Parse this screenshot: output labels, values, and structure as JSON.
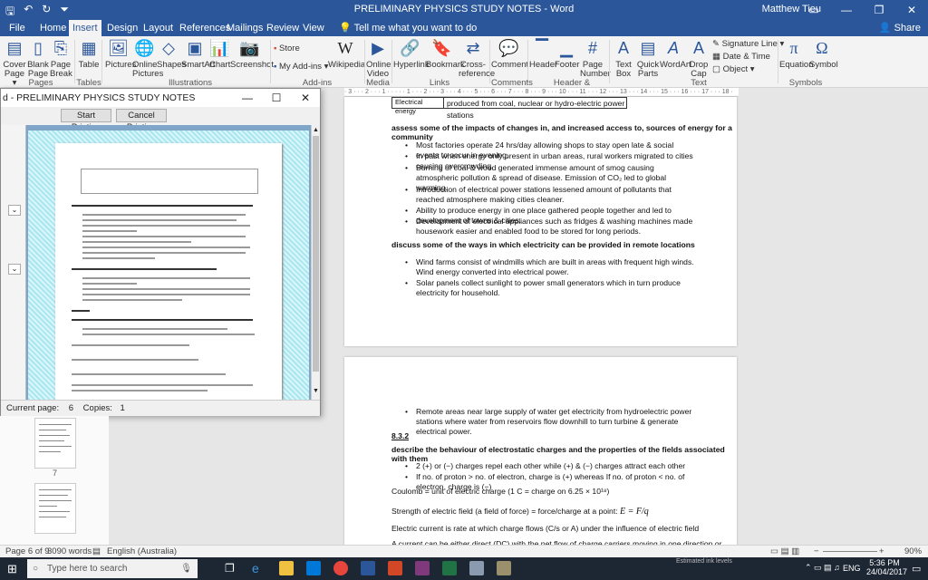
{
  "window": {
    "title": "PRELIMINARY PHYSICS STUDY NOTES - Word",
    "user": "Matthew Tieu",
    "share": "Share",
    "tell_me": "Tell me what you want to do"
  },
  "tabs": [
    "File",
    "Home",
    "Insert",
    "Design",
    "Layout",
    "References",
    "Mailings",
    "Review",
    "View"
  ],
  "ribbon": {
    "buttons": [
      {
        "label": "Cover Page ▾",
        "icon": "cover-page-icon"
      },
      {
        "label": "Blank Page",
        "icon": "blank-page-icon"
      },
      {
        "label": "Page Break",
        "icon": "page-break-icon"
      },
      {
        "label": "Table",
        "icon": "table-icon"
      },
      {
        "label": "Pictures",
        "icon": "pictures-icon"
      },
      {
        "label": "Online Pictures",
        "icon": "online-pictures-icon"
      },
      {
        "label": "Shapes",
        "icon": "shapes-icon"
      },
      {
        "label": "SmartArt",
        "icon": "smartart-icon"
      },
      {
        "label": "Chart",
        "icon": "chart-icon"
      },
      {
        "label": "Screenshot",
        "icon": "screenshot-icon"
      },
      {
        "label": "Wikipedia",
        "icon": "wikipedia-icon"
      },
      {
        "label": "Online Video",
        "icon": "online-video-icon"
      },
      {
        "label": "Hyperlink",
        "icon": "hyperlink-icon"
      },
      {
        "label": "Bookmark",
        "icon": "bookmark-icon"
      },
      {
        "label": "Cross-reference",
        "icon": "cross-reference-icon"
      },
      {
        "label": "Comment",
        "icon": "comment-icon"
      },
      {
        "label": "Header",
        "icon": "header-icon"
      },
      {
        "label": "Footer",
        "icon": "footer-icon"
      },
      {
        "label": "Page Number",
        "icon": "page-number-icon"
      },
      {
        "label": "Text Box",
        "icon": "text-box-icon"
      },
      {
        "label": "Quick Parts",
        "icon": "quick-parts-icon"
      },
      {
        "label": "WordArt",
        "icon": "wordart-icon"
      },
      {
        "label": "Drop Cap",
        "icon": "drop-cap-icon"
      },
      {
        "label": "Equation",
        "icon": "equation-icon"
      },
      {
        "label": "Symbol",
        "icon": "symbol-icon"
      }
    ],
    "store": "Store",
    "my_addins": "My Add-ins",
    "signature_line": "Signature Line",
    "date_time": "Date & Time",
    "object": "Object",
    "groups": [
      "Pages",
      "Tables",
      "Illustrations",
      "Add-ins",
      "Media",
      "Links",
      "Comments",
      "Header & Footer",
      "Text",
      "Symbols"
    ]
  },
  "ruler": "· 3 · · · 2 · · · 1 · · · · · 1 · · · 2 · · · 3 · · · 4 · · · 5 · · · 6 · · · 7 · · · 8 · · · 9 · · · 10 · · · 11 · · · 12 · · · 13 · · · 14 · · · 15 · · · 16 · · · 17 · · · 18 ·",
  "page1": {
    "table_top": "Electrical energy",
    "table_cell": "produced from coal, nuclear or hydro-electric power stations",
    "heading1": "assess some of the impacts of changes in, and increased access to, sources of energy for a community",
    "bullets1": [
      "Most factories operate 24 hrs/day allowing shops to stay open late & social events to occur in evening.",
      "In past when energy only present in urban areas, rural workers migrated to cities causing overcrowding.",
      "Burning of coal & wood generated immense amount of smog causing atmospheric pollution & spread of disease. Emission of CO₂ led to global warming.",
      "Introduction of electrical power stations lessened amount of pollutants that reached atmosphere making cities cleaner.",
      "Ability to produce energy in one place gathered people together and led to development of towns & cities.",
      "Development of electrical appliances such as fridges & washing machines made housework easier and enabled food to be stored for long periods."
    ],
    "heading2": "discuss some of the ways in which electricity can be provided in remote locations",
    "bullets2": [
      "Wind farms consist of windmills which are built in areas with frequent high winds. Wind energy converted into electrical power.",
      "Solar panels collect sunlight to power small generators which in turn produce electricity for household."
    ]
  },
  "page2": {
    "bullet0": "Remote areas near large supply of water get electricity from hydroelectric power stations where water from reservoirs flow downhill to turn turbine & generate electrical power.",
    "section": "8.3.2",
    "heading": "describe the behaviour of electrostatic charges and the properties of the fields associated with them",
    "bullets": [
      "2 (+) or (−) charges repel each other while (+) & (−) charges attract each other",
      "If no. of proton > no. of electron, charge is (+) whereas If no. of proton < no. of electron, charge is (−)"
    ],
    "coulomb": "Coulomb = unit of electric charge (1 C = charge on 6.25 × 10¹⁸)",
    "field": "Strength of electric field (a field of force) = force/charge at a point:",
    "current": "Electric current is rate at which charge flows (C/s or A) under the influence of electric field",
    "acdc": "A current can be either direct (DC) with the net flow of charge carriers moving in one direction or alternating (AC)"
  },
  "preview": {
    "title": "d - PRELIMINARY PHYSICS STUDY NOTES",
    "start_printing": "Start Printing",
    "cancel_printing": "Cancel Printing",
    "current_page_label": "Current page:",
    "current_page": "6",
    "copies_label": "Copies:",
    "copies": "1"
  },
  "thumb_page_number": "7",
  "statusbar": {
    "page": "Page 6 of 9",
    "words": "3090 words",
    "language": "English (Australia)",
    "zoom": "90%"
  },
  "taskbar": {
    "search": "Type here to search",
    "lang": "ENG",
    "time": "5:36 PM",
    "date": "24/04/2017",
    "tooltip": "Estimated ink levels"
  }
}
